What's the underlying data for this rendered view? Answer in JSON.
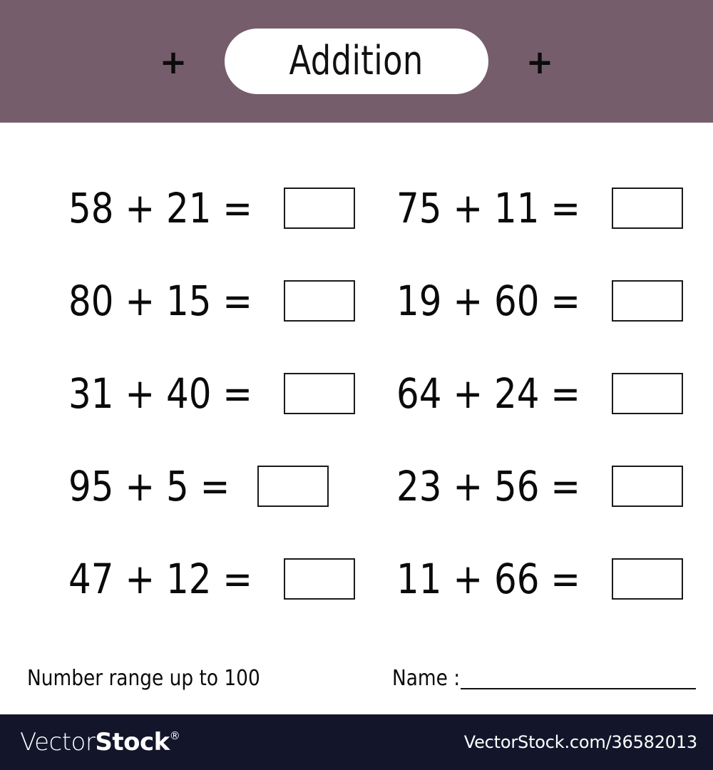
{
  "header": {
    "title": "Addition",
    "decoration_left": "+",
    "decoration_right": "+",
    "band_color": "#755D6C",
    "pill_color": "#FFFFFF"
  },
  "worksheet": {
    "operator": "+",
    "equals": "=",
    "columns": [
      {
        "name": "left-column",
        "problems": [
          {
            "expression": "58 + 21 =",
            "operand_a": "58",
            "operand_b": "21",
            "answer": ""
          },
          {
            "expression": "80 + 15 =",
            "operand_a": "80",
            "operand_b": "15",
            "answer": ""
          },
          {
            "expression": "31 + 40 =",
            "operand_a": "31",
            "operand_b": "40",
            "answer": ""
          },
          {
            "expression": "95 + 5 =",
            "operand_a": "95",
            "operand_b": "5",
            "answer": ""
          },
          {
            "expression": "47 + 12 =",
            "operand_a": "47",
            "operand_b": "12",
            "answer": ""
          }
        ]
      },
      {
        "name": "right-column",
        "problems": [
          {
            "expression": "75 + 11 =",
            "operand_a": "75",
            "operand_b": "11",
            "answer": ""
          },
          {
            "expression": "19 + 60 =",
            "operand_a": "19",
            "operand_b": "60",
            "answer": ""
          },
          {
            "expression": "64 + 24 =",
            "operand_a": "64",
            "operand_b": "24",
            "answer": ""
          },
          {
            "expression": "23 + 56 =",
            "operand_a": "23",
            "operand_b": "56",
            "answer": ""
          },
          {
            "expression": "11 + 66 =",
            "operand_a": "11",
            "operand_b": "66",
            "answer": ""
          }
        ]
      }
    ],
    "range_note": "Number range up to 100",
    "name_label": "Name :",
    "name_value": ""
  },
  "watermark": {
    "logo_part_one": "Vector",
    "logo_part_two": "Stock",
    "registered_mark": "®",
    "url": "VectorStock.com/36582013",
    "bar_color": "#13162B"
  }
}
